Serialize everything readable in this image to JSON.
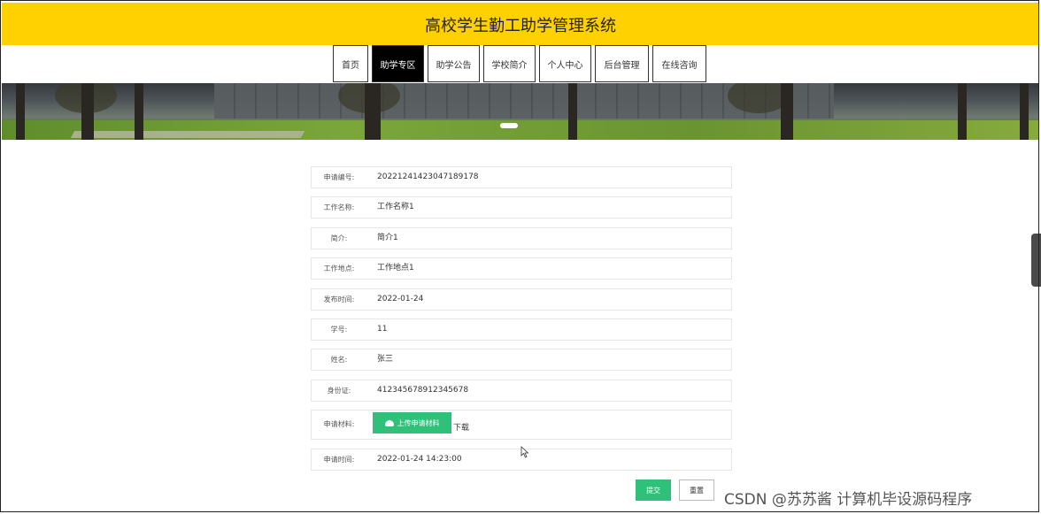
{
  "header": {
    "title": "高校学生勤工助学管理系统",
    "bg_color": "#ffd100"
  },
  "nav": [
    {
      "label": "首页"
    },
    {
      "label": "助学专区",
      "active": true
    },
    {
      "label": "助学公告"
    },
    {
      "label": "学校简介"
    },
    {
      "label": "个人中心"
    },
    {
      "label": "后台管理"
    },
    {
      "label": "在线咨询"
    }
  ],
  "form": {
    "rows": [
      {
        "label": "申请编号:",
        "value": "20221241423047189178"
      },
      {
        "label": "工作名称:",
        "value": "工作名称1"
      },
      {
        "label": "简介:",
        "value": "简介1"
      },
      {
        "label": "工作地点:",
        "value": "工作地点1"
      },
      {
        "label": "发布时间:",
        "value": "2022-01-24"
      },
      {
        "label": "学号:",
        "value": "11"
      },
      {
        "label": "姓名:",
        "value": "张三"
      },
      {
        "label": "身份证:",
        "value": "412345678912345678"
      }
    ],
    "upload": {
      "label": "申请材料:",
      "button_label": "上传申请材料",
      "download_label": "下载"
    },
    "apply_time": {
      "label": "申请时间:",
      "value": "2022-01-24 14:23:00"
    },
    "submit_label": "提交",
    "reset_label": "重置",
    "accent_color": "#2fc07a"
  },
  "watermark": "CSDN @苏苏酱    计算机毕设源码程序"
}
